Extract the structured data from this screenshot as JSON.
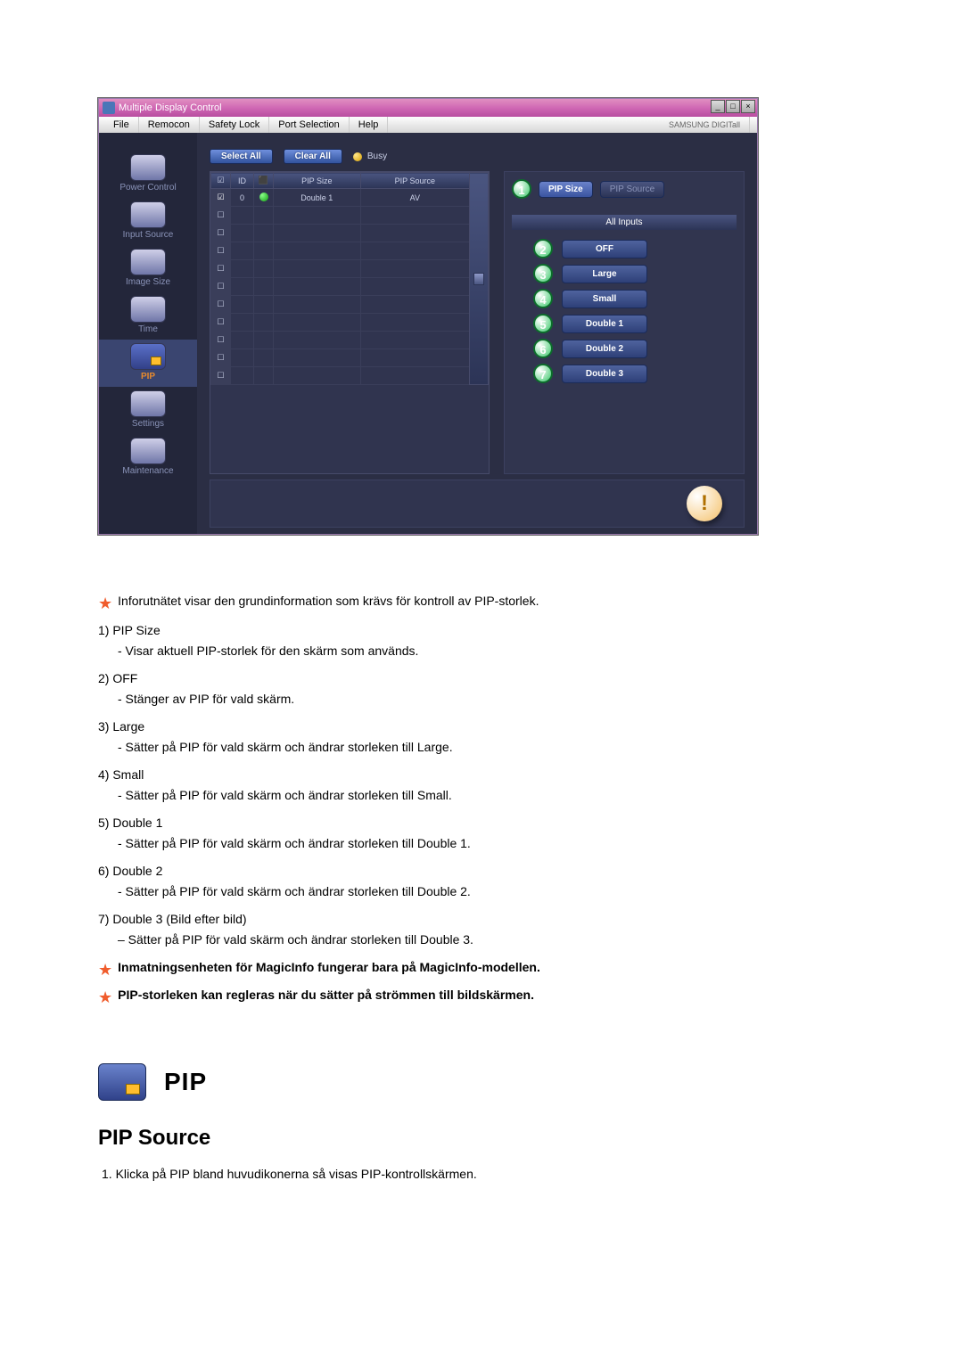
{
  "app": {
    "title": "Multiple Display Control",
    "menu": [
      "File",
      "Remocon",
      "Safety Lock",
      "Port Selection",
      "Help"
    ],
    "brand": "SAMSUNG DIGITall"
  },
  "sidebar": [
    {
      "label": "Power Control"
    },
    {
      "label": "Input Source"
    },
    {
      "label": "Image Size"
    },
    {
      "label": "Time"
    },
    {
      "label": "PIP"
    },
    {
      "label": "Settings"
    },
    {
      "label": "Maintenance"
    }
  ],
  "toolbar": {
    "select_all": "Select All",
    "clear_all": "Clear All",
    "busy": "Busy"
  },
  "table": {
    "headers": [
      "",
      "ID",
      "",
      "PIP Size",
      "PIP Source"
    ],
    "row1": {
      "id": "0",
      "size": "Double 1",
      "source": "AV"
    }
  },
  "panel": {
    "pip_size": "PIP Size",
    "pip_source": "PIP Source",
    "section": "All Inputs",
    "options": [
      "OFF",
      "Large",
      "Small",
      "Double 1",
      "Double 2",
      "Double 3"
    ]
  },
  "doc": {
    "intro": "Inforutnätet visar den grundinformation som krävs för kontroll av PIP-storlek.",
    "items": [
      {
        "num": "1)",
        "title": "PIP Size",
        "desc": "- Visar aktuell PIP-storlek för den skärm som används."
      },
      {
        "num": "2)",
        "title": "OFF",
        "desc": "- Stänger av PIP för vald skärm."
      },
      {
        "num": "3)",
        "title": "Large",
        "desc": "- Sätter på PIP för vald skärm och ändrar storleken till Large."
      },
      {
        "num": "4)",
        "title": "Small",
        "desc": "- Sätter på PIP för vald skärm och ändrar storleken till Small."
      },
      {
        "num": "5)",
        "title": "Double 1",
        "desc": "- Sätter på PIP för vald skärm och ändrar storleken till Double 1."
      },
      {
        "num": "6)",
        "title": "Double 2",
        "desc": "- Sätter på PIP för vald skärm och ändrar storleken till Double 2."
      },
      {
        "num": "7)",
        "title": "Double 3 (Bild efter bild)",
        "desc": "– Sätter på PIP för vald skärm och ändrar storleken till Double 3."
      }
    ],
    "note1": "Inmatningsenheten för MagicInfo fungerar bara på MagicInfo-modellen.",
    "note2": "PIP-storleken kan regleras när du sätter på strömmen till bildskärmen.",
    "pip_head": "PIP",
    "pip_sub": "PIP Source",
    "final": "1.  Klicka på PIP bland huvudikonerna så visas PIP-kontrollskärmen."
  }
}
